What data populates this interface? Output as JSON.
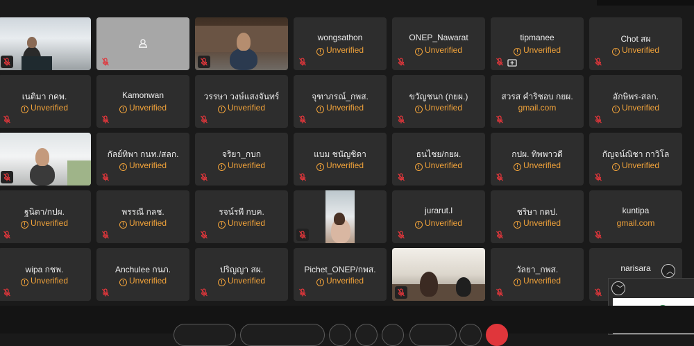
{
  "participants": [
    {
      "type": "video",
      "scene": "office"
    },
    {
      "type": "avatar"
    },
    {
      "type": "video",
      "scene": "desk"
    },
    {
      "type": "name",
      "name": "wongsathon",
      "status": "Unverified"
    },
    {
      "type": "name",
      "name": "ONEP_Nawarat",
      "status": "Unverified"
    },
    {
      "type": "name",
      "name": "tipmanee",
      "status": "Unverified",
      "sharing": true
    },
    {
      "type": "name",
      "name": "Chot สผ",
      "status": "Unverified"
    },
    {
      "type": "name",
      "name": "เนติมา กคพ.",
      "status": "Unverified"
    },
    {
      "type": "name",
      "name": "Kamonwan",
      "status": "Unverified"
    },
    {
      "type": "name",
      "name": "วรรษา  วงษ์แสงจันทร์",
      "status": "Unverified"
    },
    {
      "type": "name",
      "name": "จุฑาภรณ์_กพส.",
      "status": "Unverified"
    },
    {
      "type": "name",
      "name": "ขวัญชนก (กยผ.)",
      "status": "Unverified"
    },
    {
      "type": "name",
      "name": "สวรส คำริชอบ กยผ.",
      "status": "gmail.com",
      "email": true
    },
    {
      "type": "name",
      "name": "อักษิพร-สลก.",
      "status": "Unverified"
    },
    {
      "type": "video",
      "scene": "room"
    },
    {
      "type": "name",
      "name": "กัลย์ทิพา กนท./สลก.",
      "status": "Unverified"
    },
    {
      "type": "name",
      "name": "จริยา_กบก",
      "status": "Unverified"
    },
    {
      "type": "name",
      "name": "แบม ชนัญชิดา",
      "status": "Unverified"
    },
    {
      "type": "name",
      "name": "ธนไชย/กยผ.",
      "status": "Unverified"
    },
    {
      "type": "name",
      "name": "กปผ. ทิพพาวดี",
      "status": "Unverified"
    },
    {
      "type": "name",
      "name": "กัญจน์ณิชา  กาวิโล",
      "status": "Unverified"
    },
    {
      "type": "name",
      "name": "ฐนิตา/กปผ.",
      "status": "Unverified"
    },
    {
      "type": "name",
      "name": "พรรณี กลช.",
      "status": "Unverified"
    },
    {
      "type": "name",
      "name": "รจน์รพี กบค.",
      "status": "Unverified"
    },
    {
      "type": "video",
      "scene": "vertical"
    },
    {
      "type": "name",
      "name": "jurarut.l",
      "status": "Unverified"
    },
    {
      "type": "name",
      "name": "ชริษา กดป.",
      "status": "Unverified"
    },
    {
      "type": "name",
      "name": "kuntipa",
      "status": "gmail.com",
      "email": true
    },
    {
      "type": "name",
      "name": "wipa กชพ.",
      "status": "Unverified"
    },
    {
      "type": "name",
      "name": "Anchulee กนภ.",
      "status": "Unverified"
    },
    {
      "type": "name",
      "name": "ปริญญา สผ.",
      "status": "Unverified"
    },
    {
      "type": "name",
      "name": "Pichet_ONEP/กพส.",
      "status": "Unverified"
    },
    {
      "type": "video",
      "scene": "meeting"
    },
    {
      "type": "name",
      "name": "วัลยา_กพส.",
      "status": "Unverified"
    },
    {
      "type": "name",
      "name": "narisara",
      "status": ""
    }
  ],
  "colors": {
    "background": "#1a1a1a",
    "tile": "#2d2d2d",
    "unverified": "#f0a23a",
    "mute_red": "#e0363b"
  },
  "icons": {
    "status": "warning-circle-icon",
    "mic": "mic-muted-icon",
    "scroll_up": "chevron-up-icon",
    "scroll_down": "chevron-down-icon"
  }
}
